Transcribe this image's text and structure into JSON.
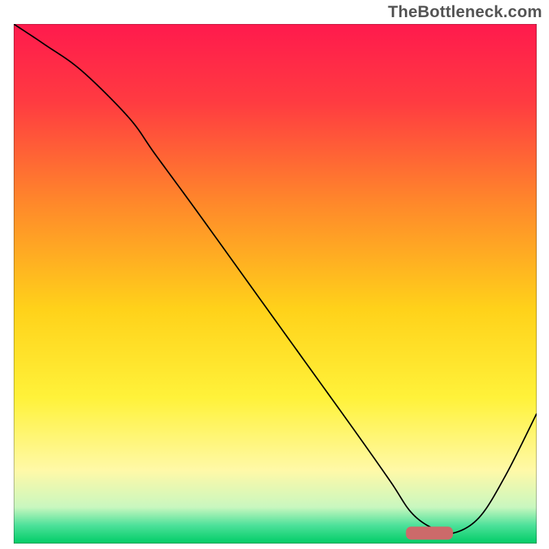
{
  "watermark": "TheBottleneck.com",
  "chart_data": {
    "type": "line",
    "title": "",
    "xlabel": "",
    "ylabel": "",
    "xlim": [
      0,
      100
    ],
    "ylim": [
      0,
      100
    ],
    "background": {
      "type": "vertical-gradient",
      "stops": [
        {
          "pos": 0.0,
          "color": "#ff1a4d"
        },
        {
          "pos": 0.15,
          "color": "#ff3b41"
        },
        {
          "pos": 0.35,
          "color": "#ff8a2a"
        },
        {
          "pos": 0.55,
          "color": "#ffd21a"
        },
        {
          "pos": 0.72,
          "color": "#fff23a"
        },
        {
          "pos": 0.86,
          "color": "#fff9a8"
        },
        {
          "pos": 0.93,
          "color": "#c9f7bf"
        },
        {
          "pos": 0.965,
          "color": "#4de19a"
        },
        {
          "pos": 1.0,
          "color": "#00cc66"
        }
      ]
    },
    "series": [
      {
        "name": "curve",
        "color": "#000000",
        "x": [
          0,
          6,
          13,
          22,
          27,
          35,
          45,
          55,
          65,
          72,
          76,
          80,
          84,
          89,
          94,
          100
        ],
        "values": [
          100,
          96,
          91,
          82,
          75,
          64,
          50,
          36,
          22,
          12,
          6,
          3,
          2,
          5,
          13,
          25
        ]
      }
    ],
    "marker": {
      "name": "optimal-band",
      "color": "#cc6a6a",
      "x_range": [
        75,
        84
      ],
      "y": 2,
      "thickness": 2.5
    }
  }
}
